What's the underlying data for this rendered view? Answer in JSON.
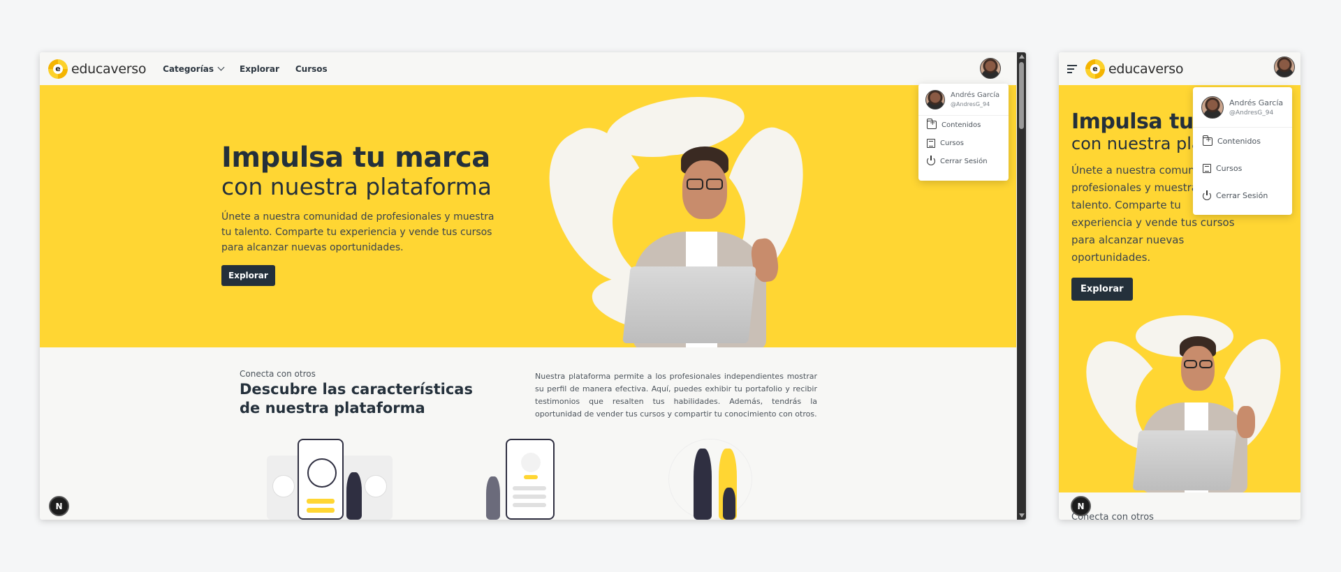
{
  "brand": {
    "name": "educaverso",
    "mark_letter": "e"
  },
  "nav": {
    "categories": "Categorías",
    "explore": "Explorar",
    "courses": "Cursos"
  },
  "hero": {
    "title": "Impulsa tu marca",
    "subtitle": "con nuestra plataforma",
    "description": "Únete a nuestra comunidad de profesionales y muestra tu talento. Comparte tu experiencia y vende tus cursos para alcanzar nuevas oportunidades.",
    "button": "Explorar"
  },
  "section": {
    "eyebrow": "Conecta con otros",
    "title": "Descubre las características de nuestra plataforma",
    "body": "Nuestra plataforma permite a los profesionales independientes mostrar su perfil de manera efectiva. Aquí, puedes exhibir tu portafolio y recibir testimonios que resalten tus habilidades. Además, tendrás la oportunidad de vender tus cursos y compartir tu conocimiento con otros."
  },
  "user_menu": {
    "name": "Andrés García",
    "handle": "@AndresG_94",
    "items": [
      "Contenidos",
      "Cursos",
      "Cerrar Sesión"
    ]
  },
  "badge": "N",
  "colors": {
    "hero_yellow": "#ffd633",
    "dark": "#24303b",
    "page_bg": "#f7f7f5"
  }
}
